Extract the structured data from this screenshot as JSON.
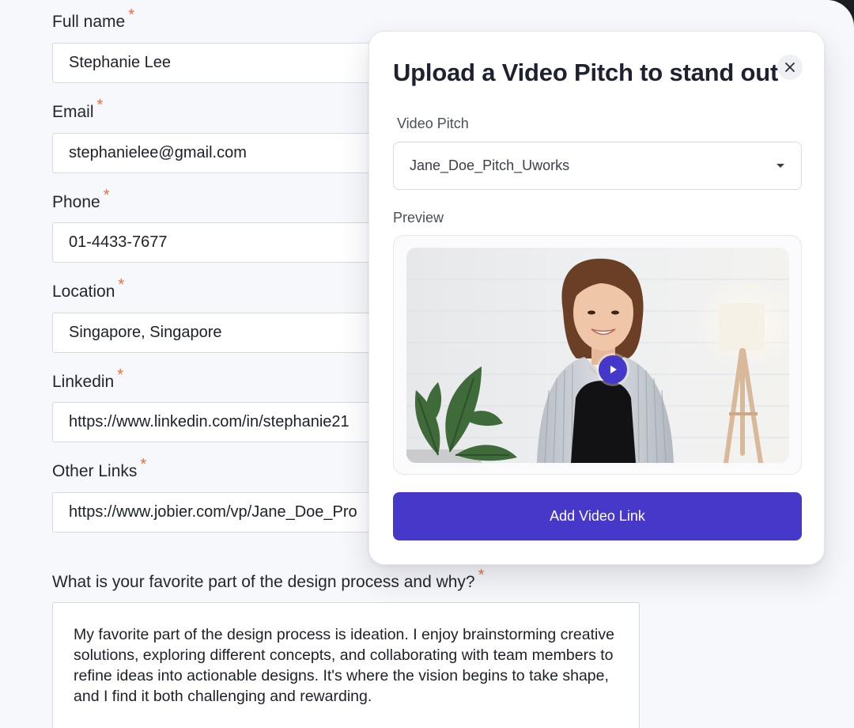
{
  "form": {
    "required_marker": "*",
    "fields": [
      {
        "label": "Full name",
        "value": "Stephanie Lee"
      },
      {
        "label": "Email",
        "value": "stephanielee@gmail.com"
      },
      {
        "label": "Phone",
        "value": "01-4433-7677"
      },
      {
        "label": "Location",
        "value": "Singapore, Singapore"
      },
      {
        "label": "Linkedin",
        "value": "https://www.linkedin.com/in/stephanie21"
      },
      {
        "label": "Other Links",
        "value": "https://www.jobier.com/vp/Jane_Doe_Pro"
      }
    ],
    "question": {
      "label": "What is your favorite part of the design process and why?",
      "answer": "My favorite part of the design process is ideation. I enjoy brainstorming creative solutions, exploring different concepts, and collaborating with team members to refine ideas into actionable designs. It's where the vision begins to take shape, and I find it both challenging and rewarding."
    }
  },
  "modal": {
    "title": "Upload a Video Pitch to stand out",
    "video_pitch_label": "Video Pitch",
    "selected_video": "Jane_Doe_Pitch_Uworks",
    "preview_label": "Preview",
    "add_button_label": "Add Video Link",
    "icons": {
      "close": "close-icon",
      "dropdown": "chevron-down-icon",
      "play": "play-icon"
    }
  },
  "colors": {
    "accent": "#4638c9",
    "required": "#f26b3a",
    "page_background": "#f7f8fb"
  }
}
